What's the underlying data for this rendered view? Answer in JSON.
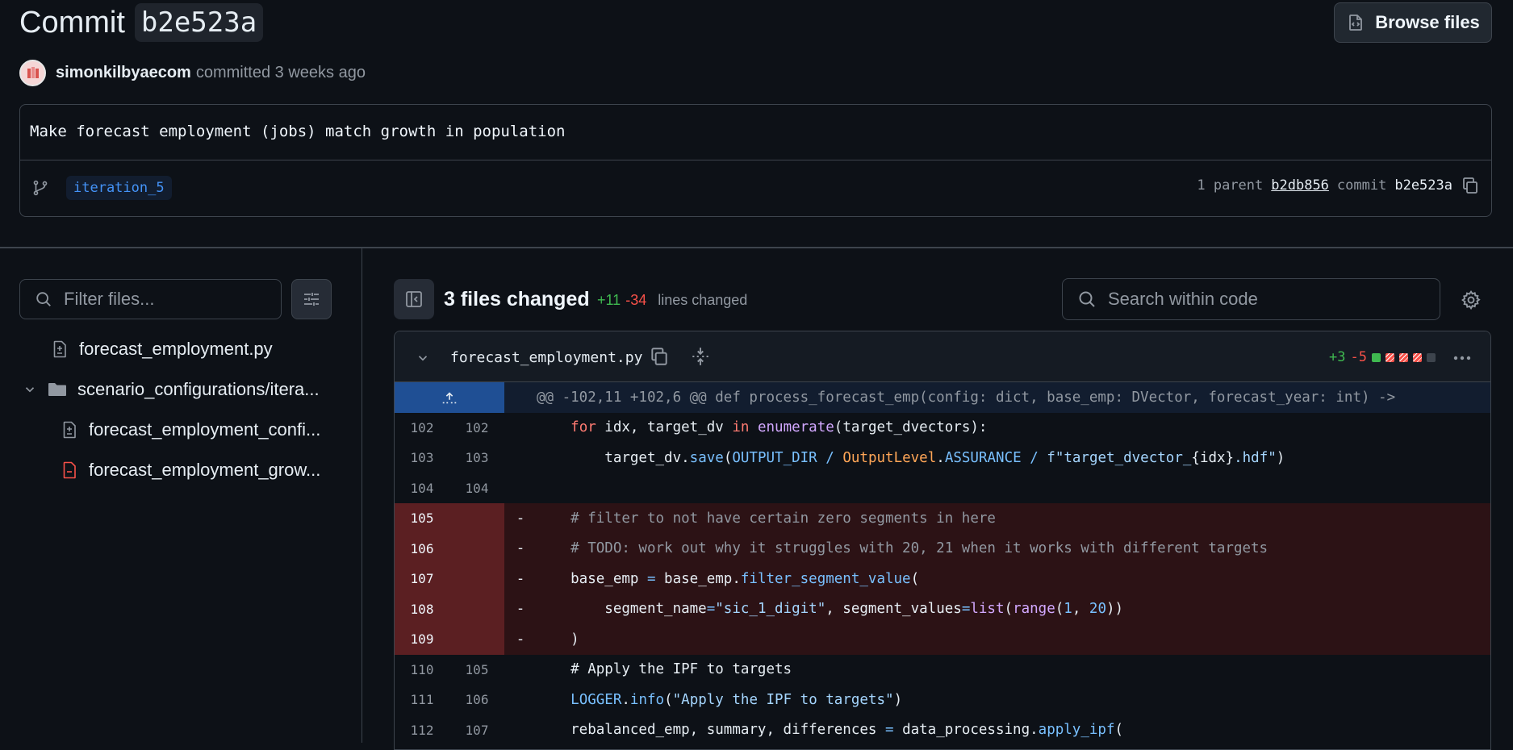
{
  "header": {
    "commit_word": "Commit",
    "commit_sha": "b2e523a",
    "browse_label": "Browse files",
    "author": "simonkilbyaecom",
    "committed_text": "committed 3 weeks ago"
  },
  "commit": {
    "message": "Make forecast employment (jobs) match growth in population",
    "branch": "iteration_5",
    "parent_label": "1 parent",
    "parent_sha": "b2db856",
    "commit_label": "commit",
    "commit_sha": "b2e523a"
  },
  "sidebar": {
    "filter_placeholder": "Filter files...",
    "tree": [
      {
        "label": "forecast_employment.py",
        "icon": "file-diff-icon"
      },
      {
        "label": "scenario_configurations/itera...",
        "icon": "folder-icon"
      },
      {
        "label": "forecast_employment_confi...",
        "icon": "file-diff-icon"
      },
      {
        "label": "forecast_employment_grow...",
        "icon": "file-removed-icon"
      }
    ]
  },
  "summary": {
    "files_changed": "3 files changed",
    "additions": "+11",
    "deletions": "-34",
    "lines_changed": "lines changed",
    "search_placeholder": "Search within code"
  },
  "diff": {
    "filename": "forecast_employment.py",
    "additions": "+3",
    "deletions": "-5",
    "hunk": "@@ -102,11 +102,6 @@ def process_forecast_emp(config: dict, base_emp: DVector, forecast_year: int) ->",
    "rows": [
      {
        "old": "102",
        "new": "102",
        "sign": "",
        "type": "ctx"
      },
      {
        "old": "103",
        "new": "103",
        "sign": "",
        "type": "ctx"
      },
      {
        "old": "104",
        "new": "104",
        "sign": "",
        "type": "ctx"
      },
      {
        "old": "105",
        "new": "",
        "sign": "-",
        "type": "del"
      },
      {
        "old": "106",
        "new": "",
        "sign": "-",
        "type": "del"
      },
      {
        "old": "107",
        "new": "",
        "sign": "-",
        "type": "del"
      },
      {
        "old": "108",
        "new": "",
        "sign": "-",
        "type": "del"
      },
      {
        "old": "109",
        "new": "",
        "sign": "-",
        "type": "del"
      },
      {
        "old": "110",
        "new": "105",
        "sign": "",
        "type": "ctx"
      },
      {
        "old": "111",
        "new": "106",
        "sign": "",
        "type": "ctx"
      },
      {
        "old": "112",
        "new": "107",
        "sign": "",
        "type": "ctx"
      }
    ],
    "code": {
      "l102": [
        "    ",
        "for",
        " idx, target_dv ",
        "in",
        " ",
        "enumerate",
        "(target_dvectors):"
      ],
      "l103": [
        "        target_dv.",
        "save",
        "(",
        "OUTPUT_DIR",
        " ",
        "/",
        " ",
        "OutputLevel",
        ".",
        "ASSURANCE",
        " ",
        "/",
        " ",
        "f\"target_dvector_",
        "{idx}",
        ".hdf\"",
        ")"
      ],
      "l104": [
        ""
      ],
      "l105": [
        "    # filter to not have certain zero segments in here"
      ],
      "l106": [
        "    # TODO: work out why it struggles with 20, 21 when it works with different targets"
      ],
      "l107": [
        "    base_emp ",
        "=",
        " base_emp.",
        "filter_segment_value",
        "("
      ],
      "l108": [
        "        segment_name",
        "=",
        "\"sic_1_digit\"",
        ", segment_values",
        "=",
        "list",
        "(",
        "range",
        "(",
        "1",
        ", ",
        "20",
        "))"
      ],
      "l109": [
        "    )"
      ],
      "l110": [
        "    # Apply the IPF to targets"
      ],
      "l111": [
        "    ",
        "LOGGER",
        ".",
        "info",
        "(",
        "\"Apply the IPF to targets\"",
        ")"
      ],
      "l112": [
        "    rebalanced_emp, summary, differences ",
        "=",
        " data_processing.",
        "apply_ipf",
        "("
      ]
    }
  },
  "colors": {
    "background": "#0d1117",
    "accent": "#4493f8",
    "addition": "#3fb950",
    "deletion": "#f85149",
    "deleted_row": "#2c1215"
  }
}
